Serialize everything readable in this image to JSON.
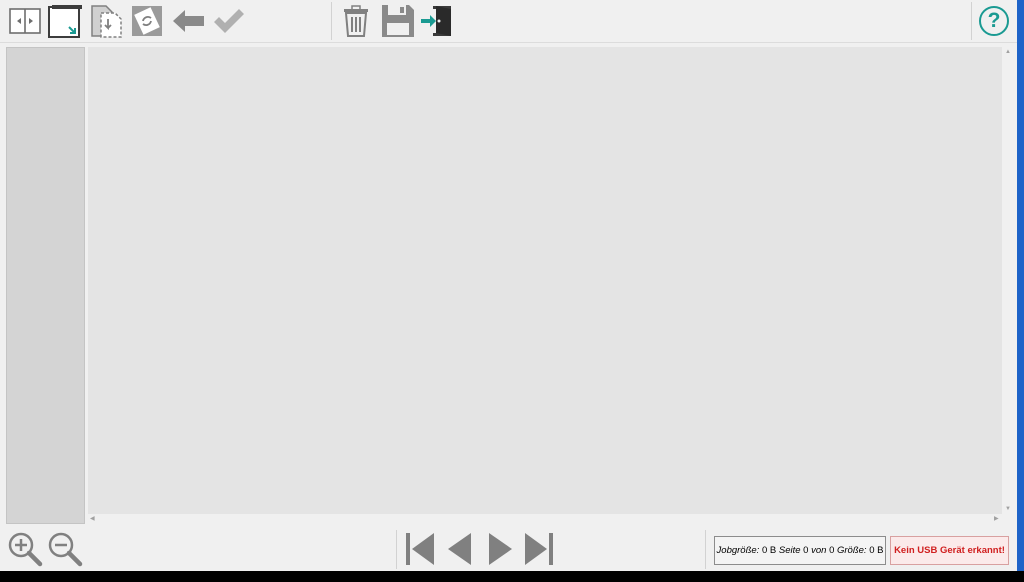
{
  "toolbar": {
    "icons": [
      "split-pages-icon",
      "fit-page-icon",
      "copy-page-icon",
      "rotate-page-icon",
      "undo-arrow-icon",
      "checkmark-icon",
      "trash-icon",
      "save-disk-icon",
      "exit-door-icon",
      "help-icon"
    ],
    "help_label": "?"
  },
  "navigation": {
    "icons": [
      "zoom-in-icon",
      "zoom-out-icon",
      "first-page-icon",
      "previous-page-icon",
      "next-page-icon",
      "last-page-icon"
    ]
  },
  "status": {
    "job_size_label": "Jobgröße:",
    "job_size_value": "0 B",
    "page_label": "Seite",
    "page_current": "0",
    "page_of_label": "von",
    "page_total": "0",
    "size_label": "Größe:",
    "size_value": "0 B",
    "usb_message": "Kein USB Gerät erkannt!"
  },
  "colors": {
    "accent": "#1a9a92",
    "icon_gray": "#808080",
    "error_text": "#d02020"
  }
}
